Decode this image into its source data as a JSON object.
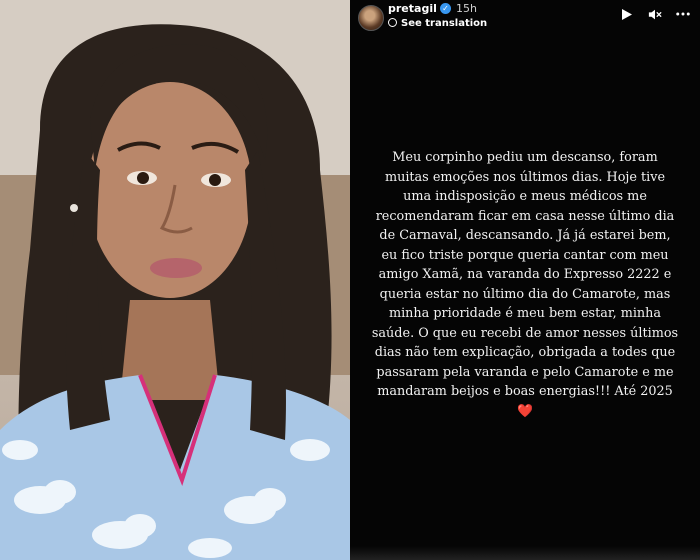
{
  "header": {
    "username": "pretagil",
    "verified_glyph": "✓",
    "time": "15h",
    "translate_label": "See translation"
  },
  "icons": {
    "play": "play-icon",
    "mute": "mute-icon",
    "more": "more-icon",
    "verified": "verified-icon",
    "globe": "globe-icon"
  },
  "story": {
    "text": "Meu corpinho pediu um descanso, foram muitas emoções nos últimos dias. Hoje tive uma indisposição e meus médicos me recomendaram ficar em casa nesse último dia de Carnaval, descansando. Já já estarei bem, eu fico triste porque queria cantar com meu amigo Xamã, na varanda do Expresso 2222 e queria estar no último dia do Camarote, mas minha prioridade é meu bem estar, minha saúde. O que eu recebi de amor nesses últimos dias não tem explicação, obrigada a todes que passaram pela varanda e pelo Camarote e me mandaram beijos e boas energias!!! Até 2025",
    "heart": "❤️"
  },
  "colors": {
    "story_bg": "#050505",
    "verified_blue": "#3897f0",
    "heart_red": "#e02020"
  }
}
